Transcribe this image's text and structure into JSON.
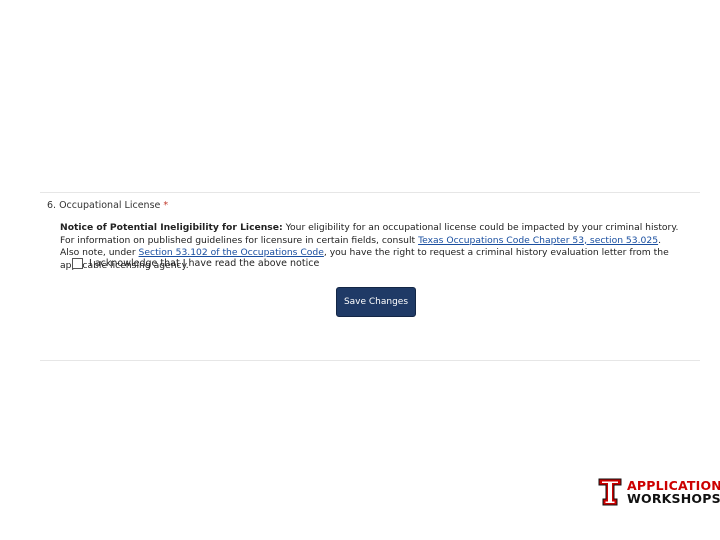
{
  "question": {
    "label": "6. Occupational License",
    "required_marker": "*"
  },
  "notice": {
    "title": "Notice of Potential Ineligibility for License:",
    "text_1": " Your eligibility for an occupational license could be impacted by your criminal history. For information on published guidelines for licensure in certain fields, consult ",
    "link_1": "Texas Occupations Code Chapter 53, section 53.025",
    "text_2": ". Also note, under ",
    "link_2": "Section 53.102 of the Occupations Code",
    "text_3": ", you have the right to request a criminal history evaluation letter from the applicable licensing agency."
  },
  "acknowledge": {
    "label": "I acknowledge that I have read the above notice",
    "checked": false
  },
  "actions": {
    "save_label": "Save Changes"
  },
  "branding": {
    "line1": "APPLICATION",
    "line2": "WORKSHOPS",
    "accent_color": "#cc0000"
  }
}
